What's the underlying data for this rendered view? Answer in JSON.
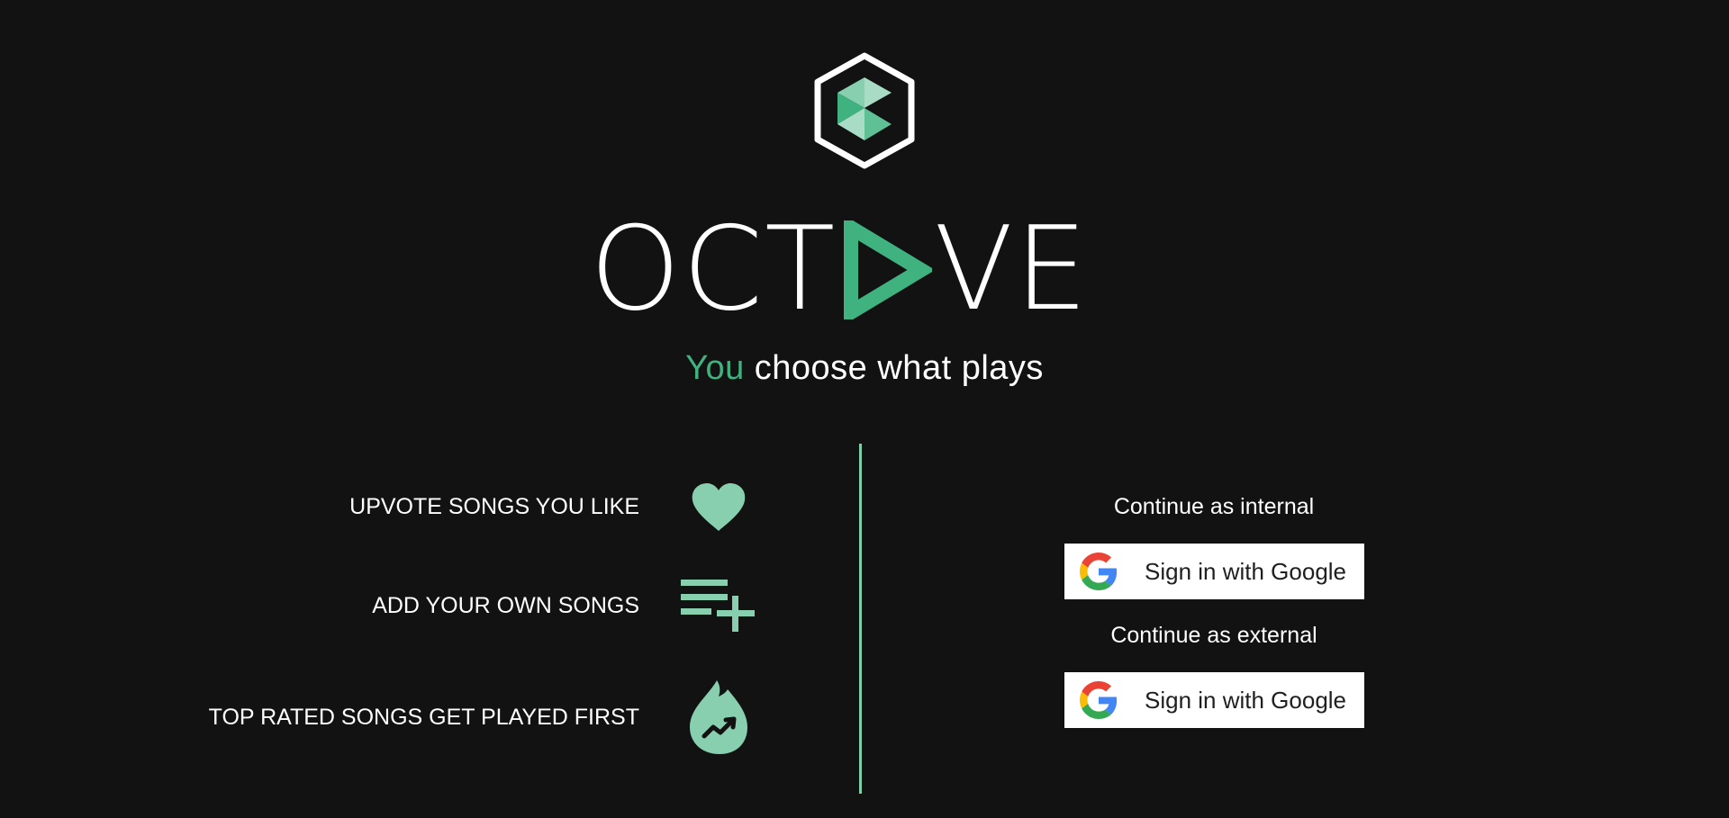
{
  "brand": {
    "wordmark_before": "OCT",
    "wordmark_after": "VE",
    "accent_color": "#3fb27f",
    "logo_icon": "hexagon-logo-icon",
    "play_icon": "play-triangle-icon"
  },
  "tagline": {
    "accent": "You",
    "rest": " choose what plays"
  },
  "features": [
    {
      "label": "UPVOTE SONGS YOU LIKE",
      "icon": "heart-icon"
    },
    {
      "label": "ADD YOUR OWN SONGS",
      "icon": "playlist-add-icon"
    },
    {
      "label": "TOP RATED SONGS GET PLAYED FIRST",
      "icon": "trending-flame-icon"
    }
  ],
  "login": {
    "internal_label": "Continue as internal",
    "external_label": "Continue as external",
    "google_button_label": "Sign in with Google"
  },
  "colors": {
    "background": "#121212",
    "icon_green": "#87cfae",
    "divider": "#7fd0a8"
  }
}
